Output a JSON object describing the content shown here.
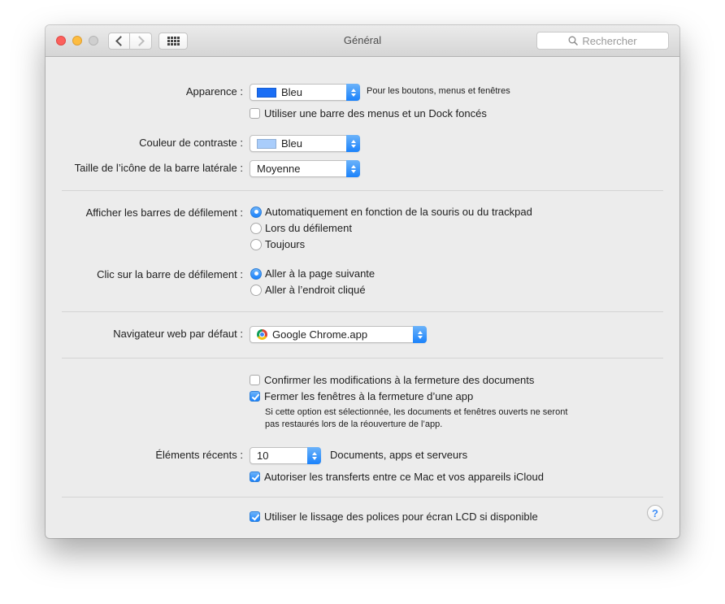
{
  "window": {
    "title": "Général",
    "search_placeholder": "Rechercher"
  },
  "appearance": {
    "label": "Apparence :",
    "value": "Bleu",
    "swatch_color": "#1a6ef5",
    "note": "Pour les boutons, menus et fenêtres",
    "dark_menu_label": "Utiliser une barre des menus et un Dock foncés",
    "dark_menu_checked": false
  },
  "highlight": {
    "label": "Couleur de contraste :",
    "value": "Bleu",
    "swatch_color": "#a9cdfb"
  },
  "sidebar_icon": {
    "label": "Taille de l’icône de la barre latérale :",
    "value": "Moyenne"
  },
  "scrollbars": {
    "label": "Afficher les barres de défilement :",
    "options": [
      {
        "label": "Automatiquement en fonction de la souris ou du trackpad",
        "selected": true
      },
      {
        "label": "Lors du défilement",
        "selected": false
      },
      {
        "label": "Toujours",
        "selected": false
      }
    ]
  },
  "scroll_click": {
    "label": "Clic sur la barre de défilement :",
    "options": [
      {
        "label": "Aller à la page suivante",
        "selected": true
      },
      {
        "label": "Aller à l’endroit cliqué",
        "selected": false
      }
    ]
  },
  "browser": {
    "label": "Navigateur web par défaut :",
    "value": "Google Chrome.app"
  },
  "documents": {
    "confirm_label": "Confirmer les modifications à la fermeture des documents",
    "confirm_checked": false,
    "close_windows_label": "Fermer les fenêtres à la fermeture d’une app",
    "close_windows_checked": true,
    "note_line1": "Si cette option est sélectionnée, les documents et fenêtres ouverts ne seront",
    "note_line2": "pas restaurés lors de la réouverture de l’app."
  },
  "recent": {
    "label": "Éléments récents :",
    "value": "10",
    "suffix": "Documents, apps et serveurs",
    "handoff_label": "Autoriser les transferts entre ce Mac et vos appareils iCloud",
    "handoff_checked": true
  },
  "font_smoothing": {
    "label": "Utiliser le lissage des polices pour écran LCD si disponible",
    "checked": true
  },
  "help": {
    "label": "?"
  }
}
